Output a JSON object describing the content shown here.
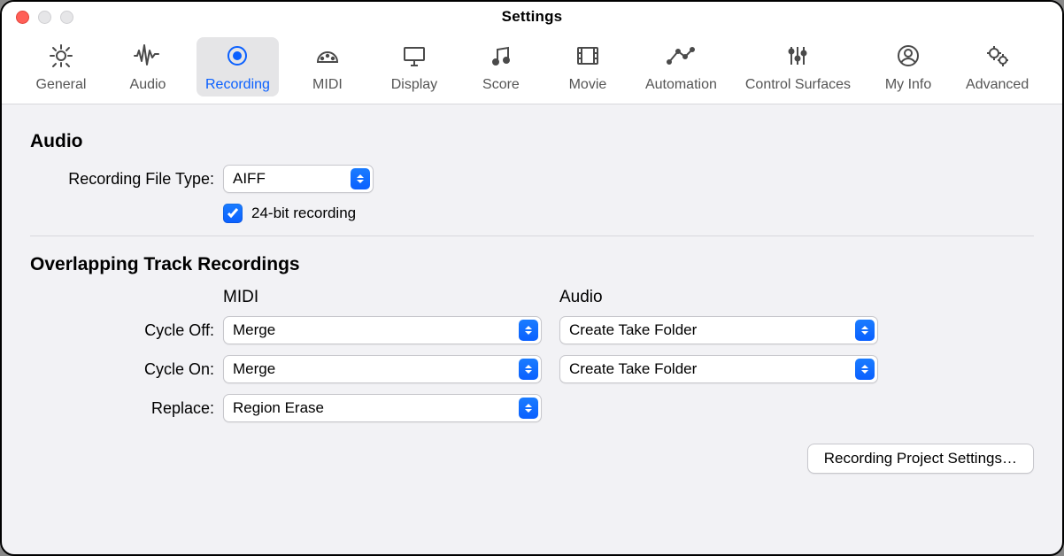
{
  "window": {
    "title": "Settings"
  },
  "tabs": [
    {
      "id": "general",
      "label": "General"
    },
    {
      "id": "audio",
      "label": "Audio"
    },
    {
      "id": "recording",
      "label": "Recording",
      "active": true
    },
    {
      "id": "midi",
      "label": "MIDI"
    },
    {
      "id": "display",
      "label": "Display"
    },
    {
      "id": "score",
      "label": "Score"
    },
    {
      "id": "movie",
      "label": "Movie"
    },
    {
      "id": "automation",
      "label": "Automation"
    },
    {
      "id": "control-surfaces",
      "label": "Control Surfaces"
    },
    {
      "id": "my-info",
      "label": "My Info"
    },
    {
      "id": "advanced",
      "label": "Advanced"
    }
  ],
  "sections": {
    "audio": {
      "title": "Audio",
      "recording_file_type_label": "Recording File Type:",
      "recording_file_type_value": "AIFF",
      "bit_depth_checkbox_label": "24-bit recording",
      "bit_depth_checked": true
    },
    "overlap": {
      "title": "Overlapping Track Recordings",
      "col_midi": "MIDI",
      "col_audio": "Audio",
      "rows": {
        "cycle_off": {
          "label": "Cycle Off:",
          "midi_value": "Merge",
          "audio_value": "Create Take Folder"
        },
        "cycle_on": {
          "label": "Cycle On:",
          "midi_value": "Merge",
          "audio_value": "Create Take Folder"
        },
        "replace": {
          "label": "Replace:",
          "midi_value": "Region Erase"
        }
      }
    }
  },
  "footer": {
    "project_settings_button": "Recording Project Settings…"
  }
}
